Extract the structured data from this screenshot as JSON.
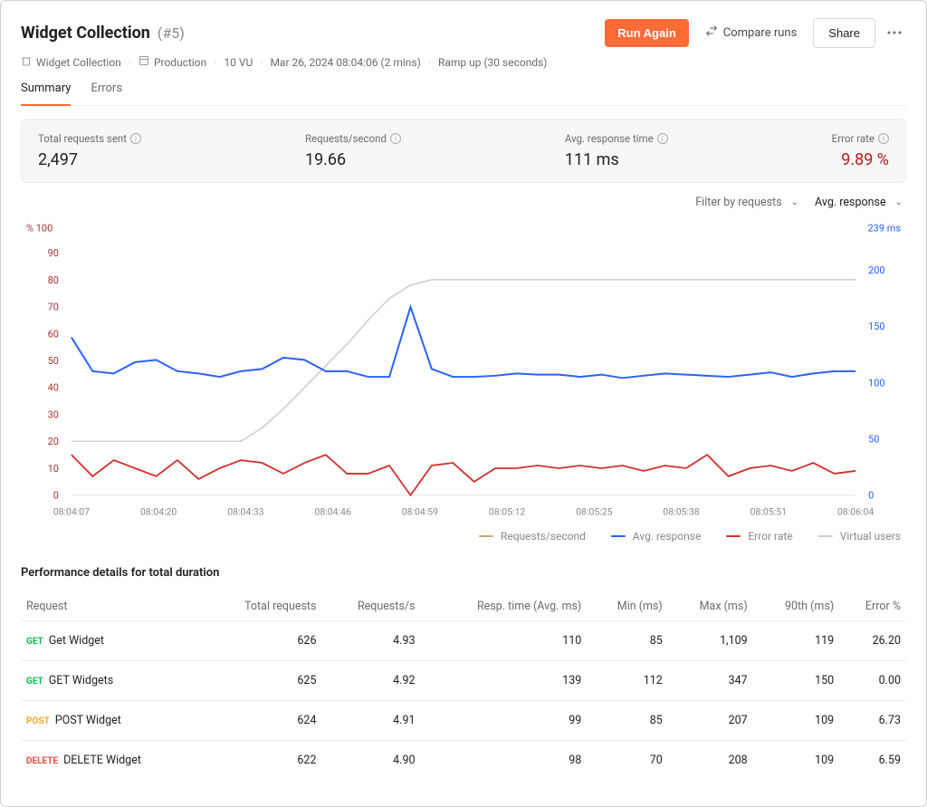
{
  "header": {
    "title": "Widget Collection",
    "run_no": "(#5)",
    "run_again": "Run Again",
    "compare": "Compare runs",
    "share": "Share"
  },
  "meta": {
    "collection": "Widget Collection",
    "env": "Production",
    "vu": "10 VU",
    "ts": "Mar 26, 2024 08:04:06 (2 mins)",
    "ramp": "Ramp up (30 seconds)"
  },
  "tabs": {
    "summary": "Summary",
    "errors": "Errors"
  },
  "stats": {
    "total_label": "Total requests sent",
    "total_val": "2,497",
    "rps_label": "Requests/second",
    "rps_val": "19.66",
    "avg_label": "Avg. response time",
    "avg_val": "111 ms",
    "err_label": "Error rate",
    "err_val": "9.89 %"
  },
  "filters": {
    "filter_by": "Filter by requests",
    "metric": "Avg. response"
  },
  "chart_axes": {
    "left_label": "% 100",
    "right_label": "239 ms",
    "left_ticks": [
      "90",
      "80",
      "70",
      "60",
      "50",
      "40",
      "30",
      "20",
      "10",
      "0"
    ],
    "right_ticks": [
      "200",
      "150",
      "100",
      "50",
      "0"
    ],
    "x_ticks": [
      "08:04:07",
      "08:04:20",
      "08:04:33",
      "08:04:46",
      "08:04:59",
      "08:05:12",
      "08:05:25",
      "08:05:38",
      "08:05:51",
      "08:06:04"
    ]
  },
  "legend": {
    "rps": "Requests/second",
    "avg": "Avg. response",
    "err": "Error rate",
    "vu": "Virtual users"
  },
  "colors": {
    "blue": "#2962ff",
    "red": "#d32f2f",
    "tan": "#c8a97a",
    "grey": "#cfcfcf"
  },
  "chart_data": {
    "type": "line",
    "x": [
      "08:04:07",
      "08:04:10",
      "08:04:14",
      "08:04:17",
      "08:04:20",
      "08:04:24",
      "08:04:27",
      "08:04:30",
      "08:04:33",
      "08:04:37",
      "08:04:40",
      "08:04:43",
      "08:04:46",
      "08:04:50",
      "08:04:53",
      "08:04:56",
      "08:04:59",
      "08:05:03",
      "08:05:06",
      "08:05:09",
      "08:05:12",
      "08:05:16",
      "08:05:19",
      "08:05:22",
      "08:05:25",
      "08:05:29",
      "08:05:32",
      "08:05:35",
      "08:05:38",
      "08:05:42",
      "08:05:45",
      "08:05:48",
      "08:05:51",
      "08:05:55",
      "08:05:58",
      "08:06:01",
      "08:06:04",
      "08:06:08"
    ],
    "series_left_pct": [
      {
        "name": "Error rate",
        "color": "red",
        "values": [
          15,
          7,
          13,
          10,
          7,
          13,
          6,
          10,
          13,
          12,
          8,
          12,
          15,
          8,
          8,
          11,
          0,
          11,
          12,
          5,
          10,
          10,
          11,
          10,
          11,
          10,
          11,
          9,
          11,
          10,
          15,
          7,
          10,
          11,
          9,
          12,
          8,
          9
        ]
      },
      {
        "name": "Virtual users",
        "color": "grey",
        "values": [
          20,
          20,
          20,
          20,
          20,
          20,
          20,
          20,
          20,
          25,
          32,
          40,
          48,
          56,
          65,
          73,
          78,
          80,
          80,
          80,
          80,
          80,
          80,
          80,
          80,
          80,
          80,
          80,
          80,
          80,
          80,
          80,
          80,
          80,
          80,
          80,
          80,
          80
        ]
      }
    ],
    "series_right_ms": [
      {
        "name": "Avg. response",
        "color": "blue",
        "values": [
          140,
          110,
          108,
          118,
          120,
          110,
          108,
          105,
          110,
          112,
          122,
          120,
          110,
          110,
          105,
          105,
          167,
          112,
          105,
          105,
          106,
          108,
          107,
          107,
          105,
          107,
          104,
          106,
          108,
          107,
          106,
          105,
          107,
          109,
          105,
          108,
          110,
          110
        ]
      }
    ],
    "left_axis": {
      "label": "%",
      "min": 0,
      "max": 100
    },
    "right_axis": {
      "label": "ms",
      "min": 0,
      "max": 239
    }
  },
  "perf": {
    "title": "Performance details for total duration",
    "cols": [
      "Request",
      "Total requests",
      "Requests/s",
      "Resp. time (Avg. ms)",
      "Min (ms)",
      "Max (ms)",
      "90th (ms)",
      "Error %"
    ],
    "rows": [
      {
        "method": "GET",
        "mclass": "m-get",
        "name": "Get Widget",
        "total": "626",
        "rps": "4.93",
        "avg": "110",
        "min": "85",
        "max": "1,109",
        "p90": "119",
        "err": "26.20"
      },
      {
        "method": "GET",
        "mclass": "m-get",
        "name": "GET Widgets",
        "total": "625",
        "rps": "4.92",
        "avg": "139",
        "min": "112",
        "max": "347",
        "p90": "150",
        "err": "0.00"
      },
      {
        "method": "POST",
        "mclass": "m-post",
        "name": "POST Widget",
        "total": "624",
        "rps": "4.91",
        "avg": "99",
        "min": "85",
        "max": "207",
        "p90": "109",
        "err": "6.73"
      },
      {
        "method": "DELETE",
        "mclass": "m-delete",
        "name": "DELETE Widget",
        "total": "622",
        "rps": "4.90",
        "avg": "98",
        "min": "70",
        "max": "208",
        "p90": "109",
        "err": "6.59"
      }
    ]
  }
}
